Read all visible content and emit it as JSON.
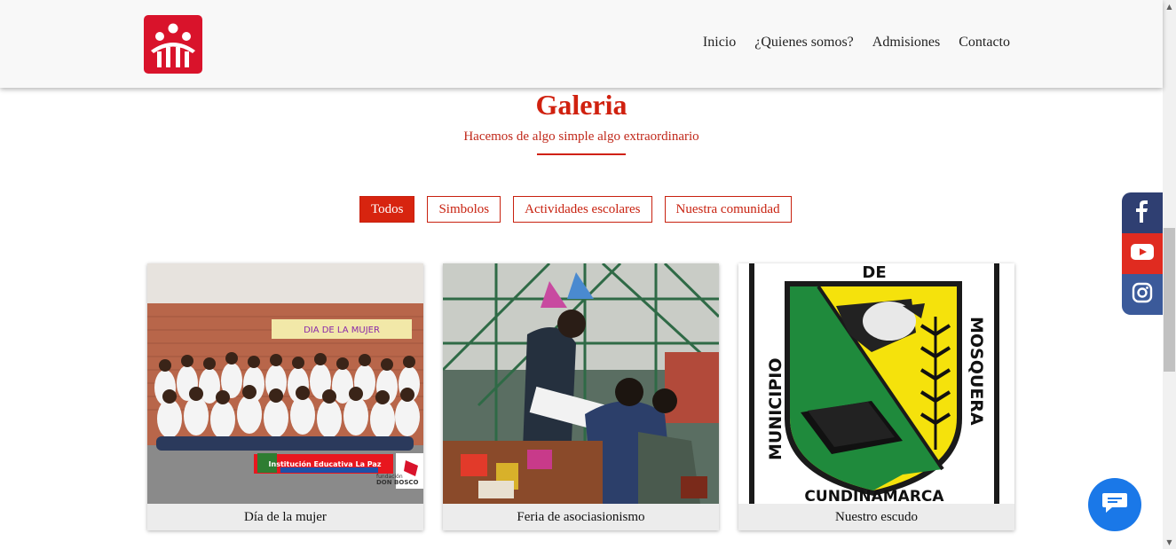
{
  "header": {
    "logo_icon": "don-bosco-logo",
    "nav": [
      "Inicio",
      "¿Quienes somos?",
      "Admisiones",
      "Contacto"
    ]
  },
  "gallery": {
    "title": "Galeria",
    "subtitle": "Hacemos de algo simple algo extraordinario",
    "filters": [
      "Todos",
      "Simbolos",
      "Actividades escolares",
      "Nuestra comunidad"
    ],
    "active_filter": "Todos",
    "items": [
      {
        "caption": "Día de la mujer",
        "banner_text": "Institución Educativa La Paz",
        "banner_brand": "DON BOSCO",
        "banner_brand_small": "fundación",
        "wall_sign": "DIA DE LA MUJER"
      },
      {
        "caption": "Feria de asociasionismo"
      },
      {
        "caption": "Nuestro escudo",
        "crest_top": "DE",
        "crest_left": "MUNICIPIO",
        "crest_right": "MOSQUERA",
        "crest_bottom": "CUNDINAMARCA"
      }
    ]
  },
  "social": {
    "icons": [
      "facebook-icon",
      "youtube-icon",
      "instagram-icon"
    ]
  },
  "chat": {
    "icon": "chat-bubble-icon"
  },
  "colors": {
    "accent": "#d0210f",
    "facebook": "#2f3f72",
    "youtube": "#e02b20",
    "instagram": "#3b5a9a",
    "chat": "#1a78e8"
  }
}
